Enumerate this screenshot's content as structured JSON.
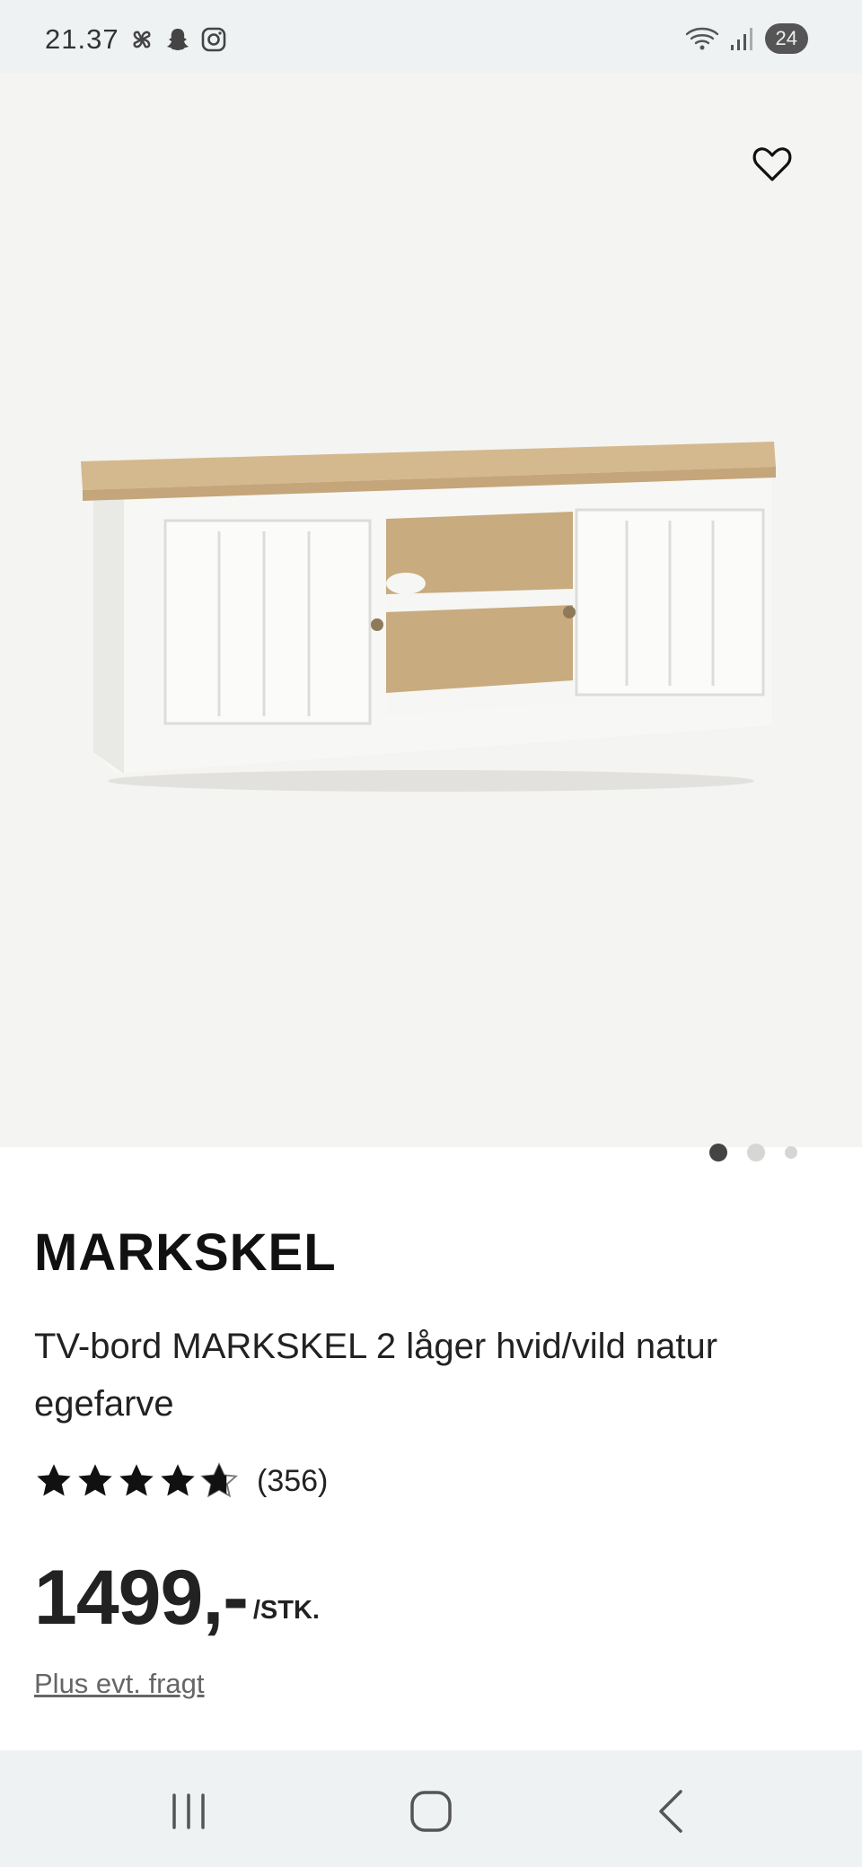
{
  "status_bar": {
    "time": "21.37",
    "battery": "24",
    "icons": [
      "pinwheel-icon",
      "snapchat-icon",
      "instagram-icon",
      "wifi-icon",
      "signal-icon"
    ]
  },
  "gallery": {
    "favorite_icon": "heart-outline-icon",
    "image_description": "tv-bench",
    "page_count": 3,
    "active_page": 1
  },
  "product": {
    "brand": "MARKSKEL",
    "title": "TV-bord MARKSKEL 2 låger hvid/vild natur egefarve",
    "rating": 4.7,
    "rating_max": 5,
    "review_count": "(356)",
    "price": "1499,-",
    "unit": "/STK.",
    "shipping_note": "Plus evt. fragt"
  },
  "nav": {
    "recents_icon": "recents-icon",
    "home_icon": "home-icon",
    "back_icon": "back-icon"
  },
  "colors": {
    "gallery_bg": "#f4f4f3",
    "system_bar_bg": "#eef2f2",
    "text": "#111111",
    "muted": "#666666",
    "oak": "#d4b98e"
  }
}
